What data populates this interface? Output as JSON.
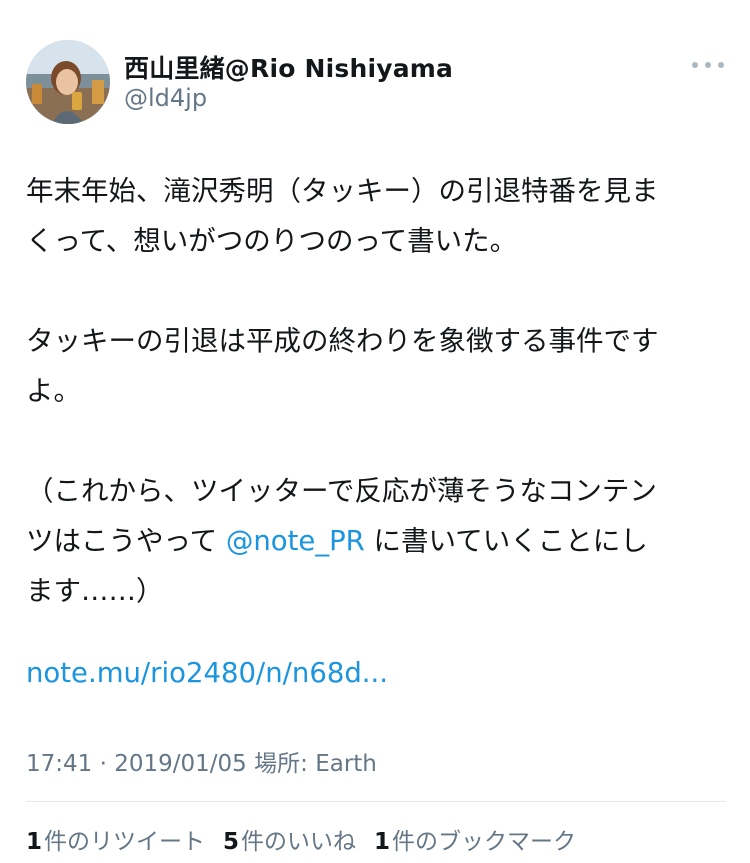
{
  "user": {
    "display_name": "西山里緒@Rio Nishiyama",
    "handle": "@ld4jp"
  },
  "tweet": {
    "line1": "年末年始、滝沢秀明（タッキー）の引退特番を見ま",
    "line2": "くって、想いがつのりつのって書いた。",
    "line3": "タッキーの引退は平成の終わりを象徴する事件です",
    "line4": "よ。",
    "line5": "（これから、ツイッターで反応が薄そうなコンテン",
    "line6_before": "ツはこうやって ",
    "mention": "@note_PR",
    "line6_after": " に書いていくことにし",
    "line7": "ます……）",
    "link": "note.mu/rio2480/n/n68d..."
  },
  "meta": {
    "time": "17:41",
    "separator": " · ",
    "date": "2019/01/05",
    "location_label": " 場所: ",
    "location": "Earth"
  },
  "stats": {
    "retweets_count": "1",
    "retweets_label": "件のリツイート",
    "likes_count": "5",
    "likes_label": "件のいいね",
    "bookmarks_count": "1",
    "bookmarks_label": "件のブックマーク"
  },
  "colors": {
    "link": "#1b95e0",
    "secondary_text": "#657786",
    "primary_text": "#14171a"
  },
  "icons": {
    "more": "more-horizontal-icon"
  }
}
